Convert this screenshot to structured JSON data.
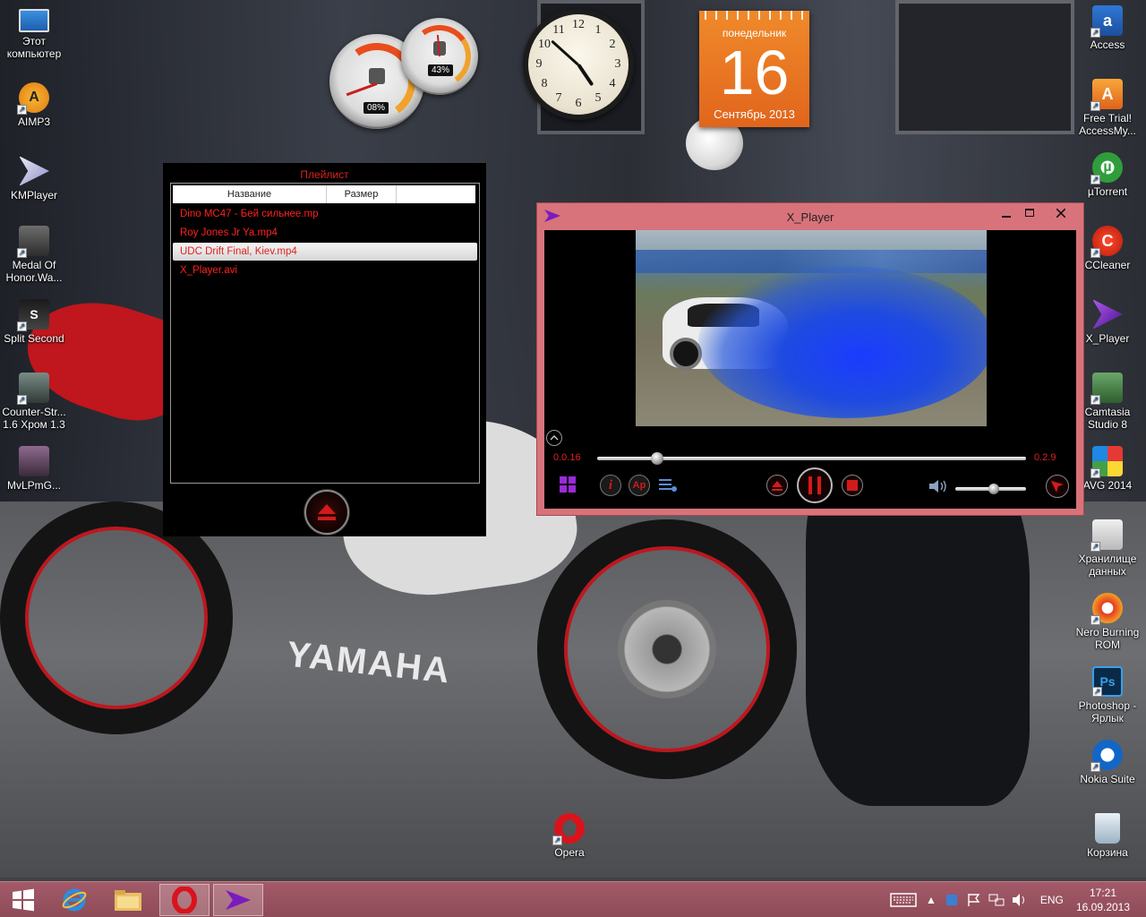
{
  "desktop_left": [
    {
      "label": "Этот компьютер",
      "icon": "computer-icon"
    },
    {
      "label": "AIMP3",
      "icon": "aimp-icon"
    },
    {
      "label": "KMPlayer",
      "icon": "kmplayer-icon"
    },
    {
      "label": "Medal Of Honor.Wa...",
      "icon": "game-icon"
    },
    {
      "label": "Split Second",
      "icon": "game-icon"
    },
    {
      "label": "Counter-Str... 1.6 Хром 1.3",
      "icon": "game-icon"
    },
    {
      "label": "MvLPmG...",
      "icon": "game-icon"
    }
  ],
  "desktop_right": [
    {
      "label": "Access",
      "icon": "access-icon"
    },
    {
      "label": "Free Trial! AccessMy...",
      "icon": "access-trial-icon"
    },
    {
      "label": "µTorrent",
      "icon": "utorrent-icon"
    },
    {
      "label": "CCleaner",
      "icon": "ccleaner-icon"
    },
    {
      "label": "X_Player",
      "icon": "xplayer-icon"
    },
    {
      "label": "Camtasia Studio 8",
      "icon": "camtasia-icon"
    },
    {
      "label": "AVG 2014",
      "icon": "avg-icon"
    },
    {
      "label": "Хранилище данных",
      "icon": "storage-icon"
    },
    {
      "label": "Nero Burning ROM",
      "icon": "nero-icon"
    },
    {
      "label": "Photoshop - Ярлык",
      "icon": "photoshop-icon"
    },
    {
      "label": "Nokia Suite",
      "icon": "nokia-icon"
    },
    {
      "label": "Корзина",
      "icon": "recycle-bin-icon"
    }
  ],
  "desktop_bottom": {
    "label": "Opera",
    "icon": "opera-icon"
  },
  "wallpaper": {
    "brand_text": "YAMAHA"
  },
  "gadgets": {
    "cpu": {
      "percent_text": "08%",
      "value": 0.08
    },
    "ram": {
      "percent_text": "43%",
      "value": 0.43
    },
    "clock": {
      "hour": 4,
      "minute": 52
    },
    "calendar": {
      "weekday": "понедельник",
      "day": "16",
      "month_year": "Сентябрь 2013"
    }
  },
  "playlist": {
    "title": "Плейлист",
    "columns": [
      "Название",
      "Размер"
    ],
    "items": [
      {
        "name": "Dino MC47 - Бей сильнее.mp"
      },
      {
        "name": "Roy Jones Jr Ya.mp4"
      },
      {
        "name": "UDC Drift Final, Kiev.mp4",
        "selected": true
      },
      {
        "name": "X_Player.avi"
      }
    ]
  },
  "player": {
    "title": "X_Player",
    "time_current": "0.0.16",
    "time_total": "0.2.9",
    "progress": 0.14,
    "volume": 0.55
  },
  "taskbar": {
    "language": "ENG",
    "time": "17:21",
    "date": "16.09.2013"
  },
  "colors": {
    "accent_red": "#e02020",
    "player_frame": "#d8737b",
    "taskbar": "#9a5462"
  }
}
